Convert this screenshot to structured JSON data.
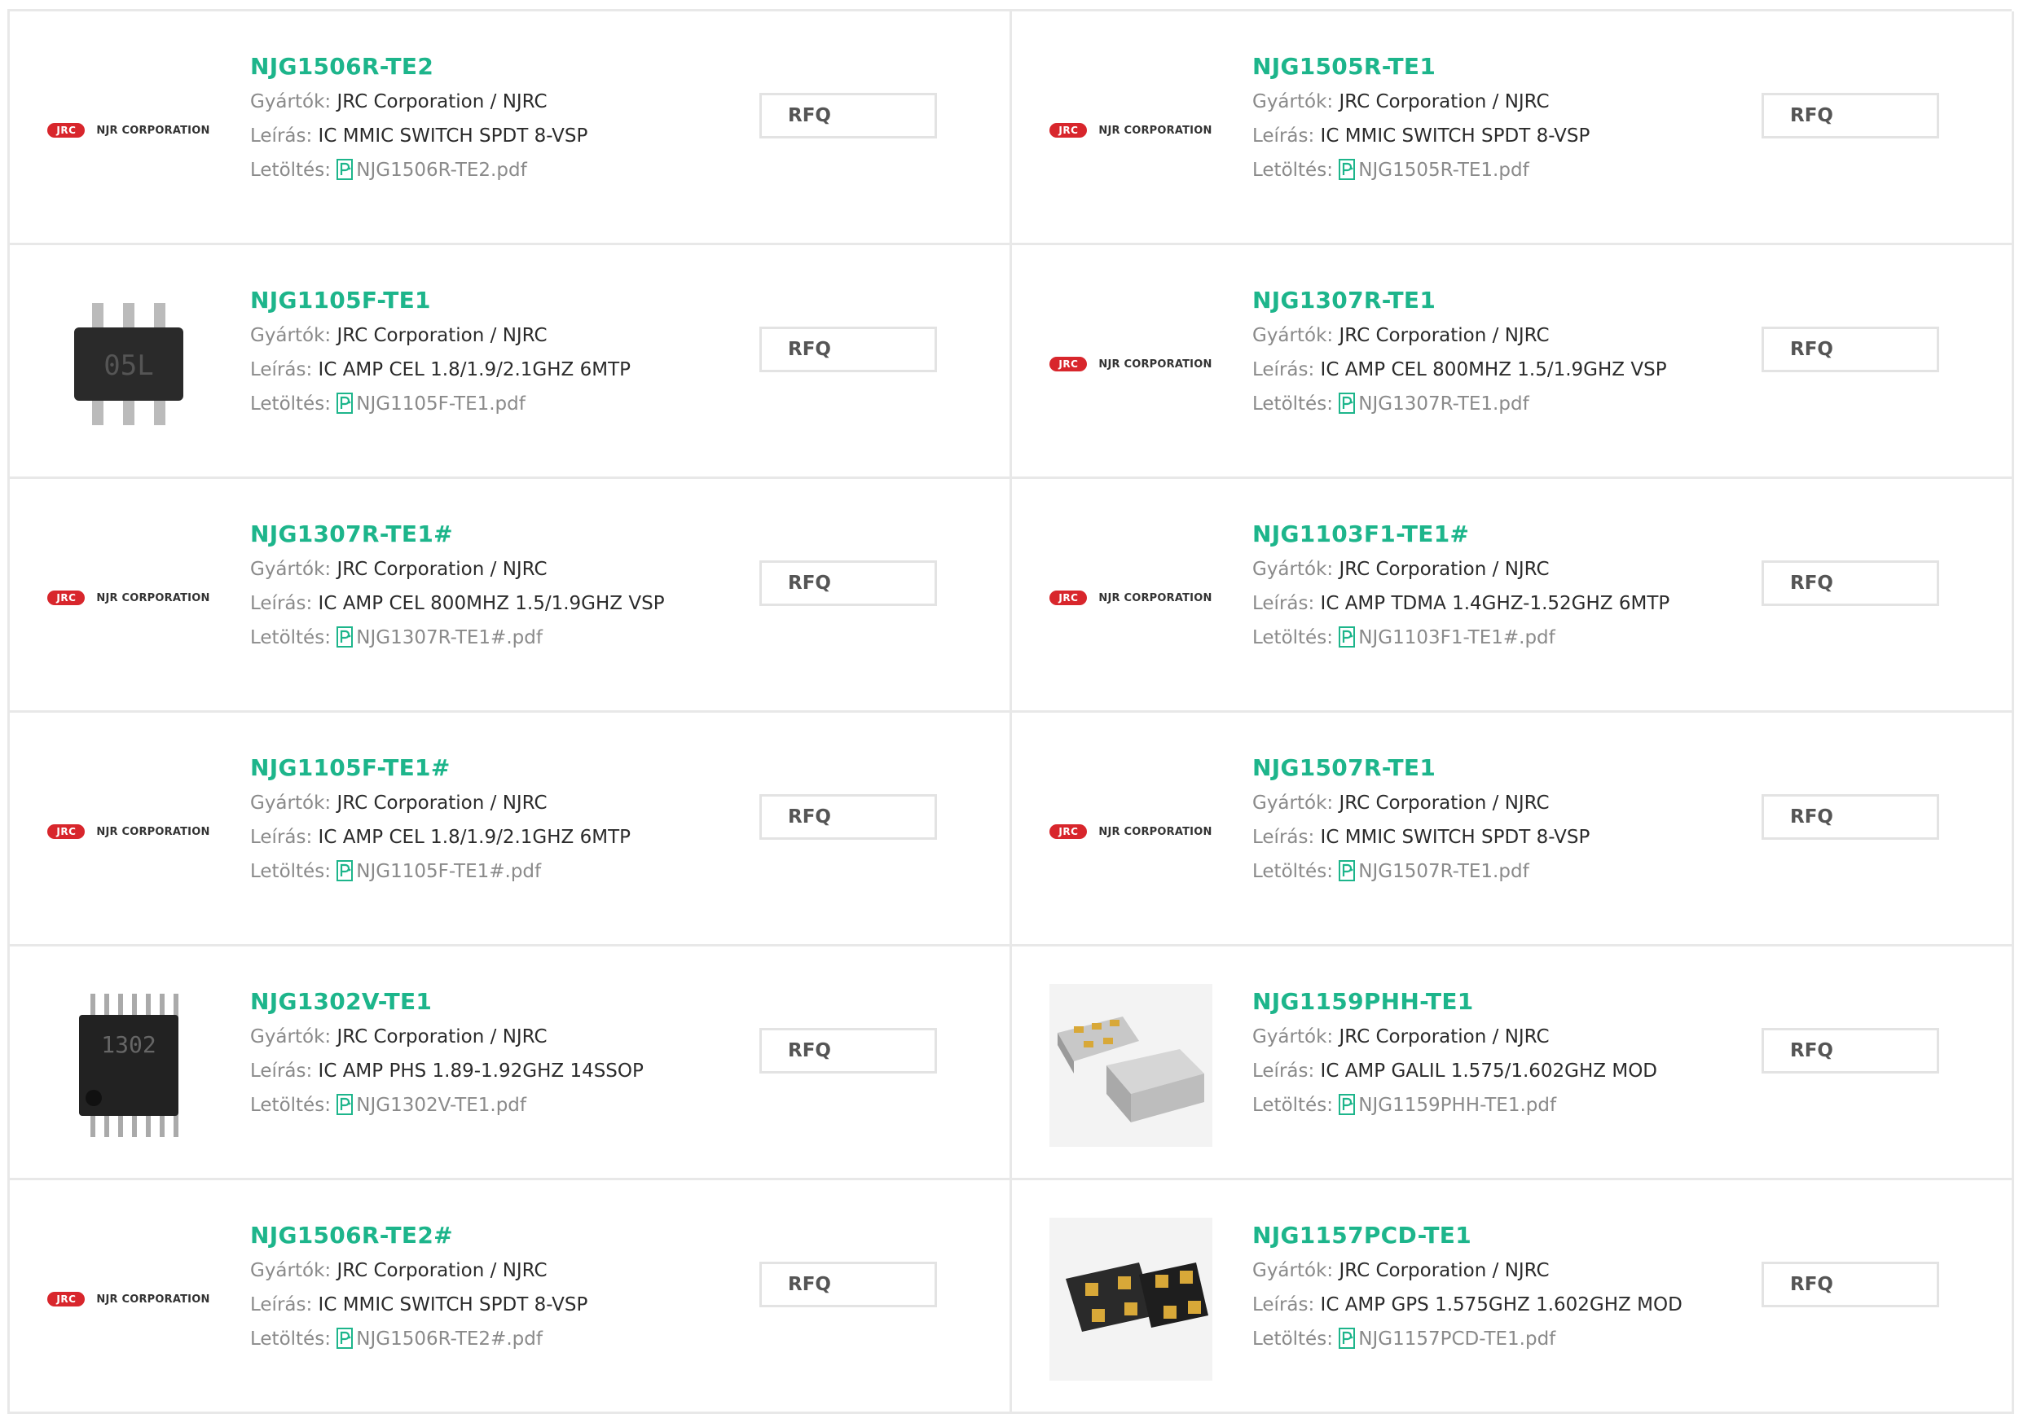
{
  "labels": {
    "manufacturer": "Gyártók:",
    "description": "Leírás:",
    "download": "Letöltés:",
    "rfq": "RFQ"
  },
  "brand": {
    "badge": "JRC",
    "name": "NJR CORPORATION",
    "accent": "#1db58b",
    "logo_red": "#d8262c"
  },
  "products": [
    {
      "pn": "NJG1506R-TE2",
      "manufacturer": "JRC Corporation / NJRC",
      "description": "IC MMIC SWITCH SPDT 8-VSP",
      "pdf": "NJG1506R-TE2.pdf",
      "image": "logo"
    },
    {
      "pn": "NJG1505R-TE1",
      "manufacturer": "JRC Corporation / NJRC",
      "description": "IC MMIC SWITCH SPDT 8-VSP",
      "pdf": "NJG1505R-TE1.pdf",
      "image": "logo"
    },
    {
      "pn": "NJG1105F-TE1",
      "manufacturer": "JRC Corporation / NJRC",
      "description": "IC AMP CEL 1.8/1.9/2.1GHZ 6MTP",
      "pdf": "NJG1105F-TE1.pdf",
      "image": "chip-6",
      "chip_mark": "05L"
    },
    {
      "pn": "NJG1307R-TE1",
      "manufacturer": "JRC Corporation / NJRC",
      "description": "IC AMP CEL 800MHZ 1.5/1.9GHZ VSP",
      "pdf": "NJG1307R-TE1.pdf",
      "image": "logo"
    },
    {
      "pn": "NJG1307R-TE1#",
      "manufacturer": "JRC Corporation / NJRC",
      "description": "IC AMP CEL 800MHZ 1.5/1.9GHZ VSP",
      "pdf": "NJG1307R-TE1#.pdf",
      "image": "logo"
    },
    {
      "pn": "NJG1103F1-TE1#",
      "manufacturer": "JRC Corporation / NJRC",
      "description": "IC AMP TDMA 1.4GHZ-1.52GHZ 6MTP",
      "pdf": "NJG1103F1-TE1#.pdf",
      "image": "logo"
    },
    {
      "pn": "NJG1105F-TE1#",
      "manufacturer": "JRC Corporation / NJRC",
      "description": "IC AMP CEL 1.8/1.9/2.1GHZ 6MTP",
      "pdf": "NJG1105F-TE1#.pdf",
      "image": "logo"
    },
    {
      "pn": "NJG1507R-TE1",
      "manufacturer": "JRC Corporation / NJRC",
      "description": "IC MMIC SWITCH SPDT 8-VSP",
      "pdf": "NJG1507R-TE1.pdf",
      "image": "logo"
    },
    {
      "pn": "NJG1302V-TE1",
      "manufacturer": "JRC Corporation / NJRC",
      "description": "IC AMP PHS 1.89-1.92GHZ 14SSOP",
      "pdf": "NJG1302V-TE1.pdf",
      "image": "chip-14",
      "chip_mark": "1302"
    },
    {
      "pn": "NJG1159PHH-TE1",
      "manufacturer": "JRC Corporation / NJRC",
      "description": "IC AMP GALIL 1.575/1.602GHZ MOD",
      "pdf": "NJG1159PHH-TE1.pdf",
      "image": "module-gray"
    },
    {
      "pn": "NJG1506R-TE2#",
      "manufacturer": "JRC Corporation / NJRC",
      "description": "IC MMIC SWITCH SPDT 8-VSP",
      "pdf": "NJG1506R-TE2#.pdf",
      "image": "logo"
    },
    {
      "pn": "NJG1157PCD-TE1",
      "manufacturer": "JRC Corporation / NJRC",
      "description": "IC AMP GPS 1.575GHZ 1.602GHZ MOD",
      "pdf": "NJG1157PCD-TE1.pdf",
      "image": "module-dark"
    }
  ]
}
